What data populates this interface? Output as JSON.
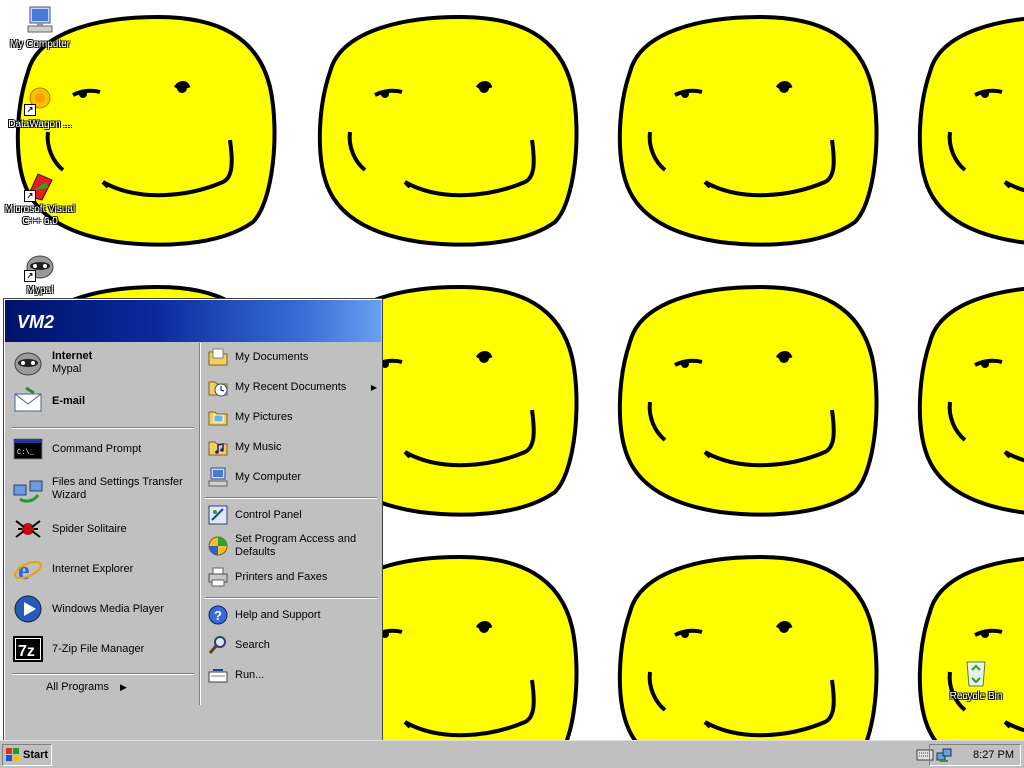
{
  "desktop_icons": [
    {
      "label": "My Computer",
      "icon": "my-computer-icon"
    },
    {
      "label": "DataWagon ...",
      "icon": "datawagon-icon"
    },
    {
      "label": "Microsoft Visual C++ 6.0",
      "icon": "visual-cpp-icon"
    },
    {
      "label": "Mypal",
      "icon": "mypal-icon"
    },
    {
      "label": "Recycle Bin",
      "icon": "recycle-bin-icon"
    }
  ],
  "start_menu": {
    "user": "VM2",
    "pinned": [
      {
        "title": "Internet",
        "subtitle": "Mypal",
        "icon": "raccoon-browser-icon"
      },
      {
        "title": "E-mail",
        "icon": "email-icon"
      }
    ],
    "recent": [
      {
        "label": "Command Prompt",
        "icon": "command-prompt-icon"
      },
      {
        "label": "Files and Settings Transfer Wizard",
        "icon": "transfer-wizard-icon"
      },
      {
        "label": "Spider Solitaire",
        "icon": "spider-solitaire-icon"
      },
      {
        "label": "Internet Explorer",
        "icon": "internet-explorer-icon"
      },
      {
        "label": "Windows Media Player",
        "icon": "media-player-icon"
      },
      {
        "label": "7-Zip File Manager",
        "icon": "7zip-icon"
      }
    ],
    "all_programs": "All Programs",
    "right_places": [
      {
        "label": "My Documents",
        "icon": "my-documents-icon"
      },
      {
        "label": "My Recent Documents",
        "icon": "recent-documents-icon"
      },
      {
        "label": "My Pictures",
        "icon": "my-pictures-icon"
      },
      {
        "label": "My Music",
        "icon": "my-music-icon"
      },
      {
        "label": "My Computer",
        "icon": "my-computer-icon"
      }
    ],
    "right_settings": [
      {
        "label": "Control Panel",
        "icon": "control-panel-icon"
      },
      {
        "label": "Set Program Access and Defaults",
        "icon": "program-access-icon"
      },
      {
        "label": "Printers and Faxes",
        "icon": "printer-icon"
      }
    ],
    "right_tools": [
      {
        "label": "Help and Support",
        "icon": "help-icon"
      },
      {
        "label": "Search",
        "icon": "search-icon"
      },
      {
        "label": "Run...",
        "icon": "run-icon"
      }
    ]
  },
  "taskbar": {
    "start_label": "Start",
    "clock": "8:27 PM"
  },
  "colors": {
    "smiley": "#ffff00",
    "start_header": "#0a2a9c",
    "menu_bg": "#c0c0c0"
  }
}
